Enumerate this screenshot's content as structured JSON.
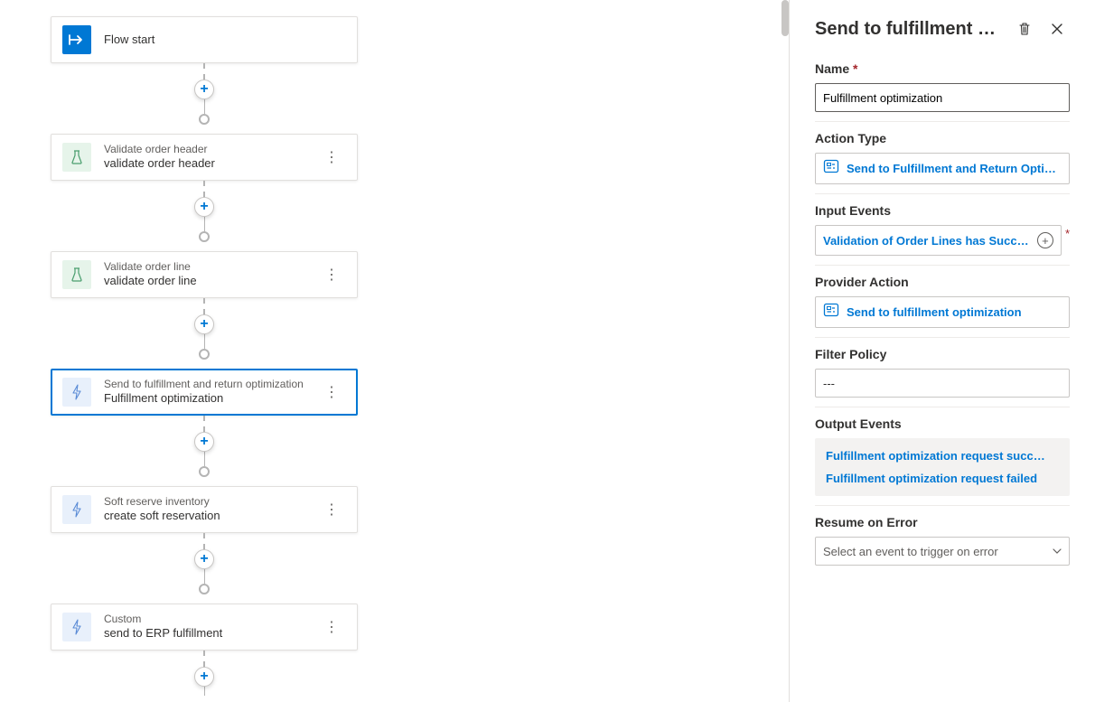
{
  "flow": {
    "start_label": "Flow start",
    "nodes": [
      {
        "sub": "Validate order header",
        "title": "validate order header",
        "icon": "flask",
        "selected": false,
        "icon_class": "green"
      },
      {
        "sub": "Validate order line",
        "title": "validate order line",
        "icon": "flask",
        "selected": false,
        "icon_class": "green"
      },
      {
        "sub": "Send to fulfillment and return optimization",
        "title": "Fulfillment optimization",
        "icon": "bolt",
        "selected": true,
        "icon_class": "lightblue"
      },
      {
        "sub": "Soft reserve inventory",
        "title": "create soft reservation",
        "icon": "bolt",
        "selected": false,
        "icon_class": "lightblue"
      },
      {
        "sub": "Custom",
        "title": "send to ERP fulfillment",
        "icon": "bolt",
        "selected": false,
        "icon_class": "lightblue"
      }
    ]
  },
  "panel": {
    "title": "Send to fulfillment an…",
    "name_label": "Name",
    "name_value": "Fulfillment optimization",
    "action_type_label": "Action Type",
    "action_type_value": "Send to Fulfillment and Return Optimiza…",
    "input_events_label": "Input Events",
    "input_events_value": "Validation of Order Lines has Succeed…",
    "provider_action_label": "Provider Action",
    "provider_action_value": "Send to fulfillment optimization",
    "filter_policy_label": "Filter Policy",
    "filter_policy_value": "---",
    "output_events_label": "Output Events",
    "output_events": [
      "Fulfillment optimization request succ…",
      "Fulfillment optimization request failed"
    ],
    "resume_label": "Resume on Error",
    "resume_placeholder": "Select an event to trigger on error"
  }
}
